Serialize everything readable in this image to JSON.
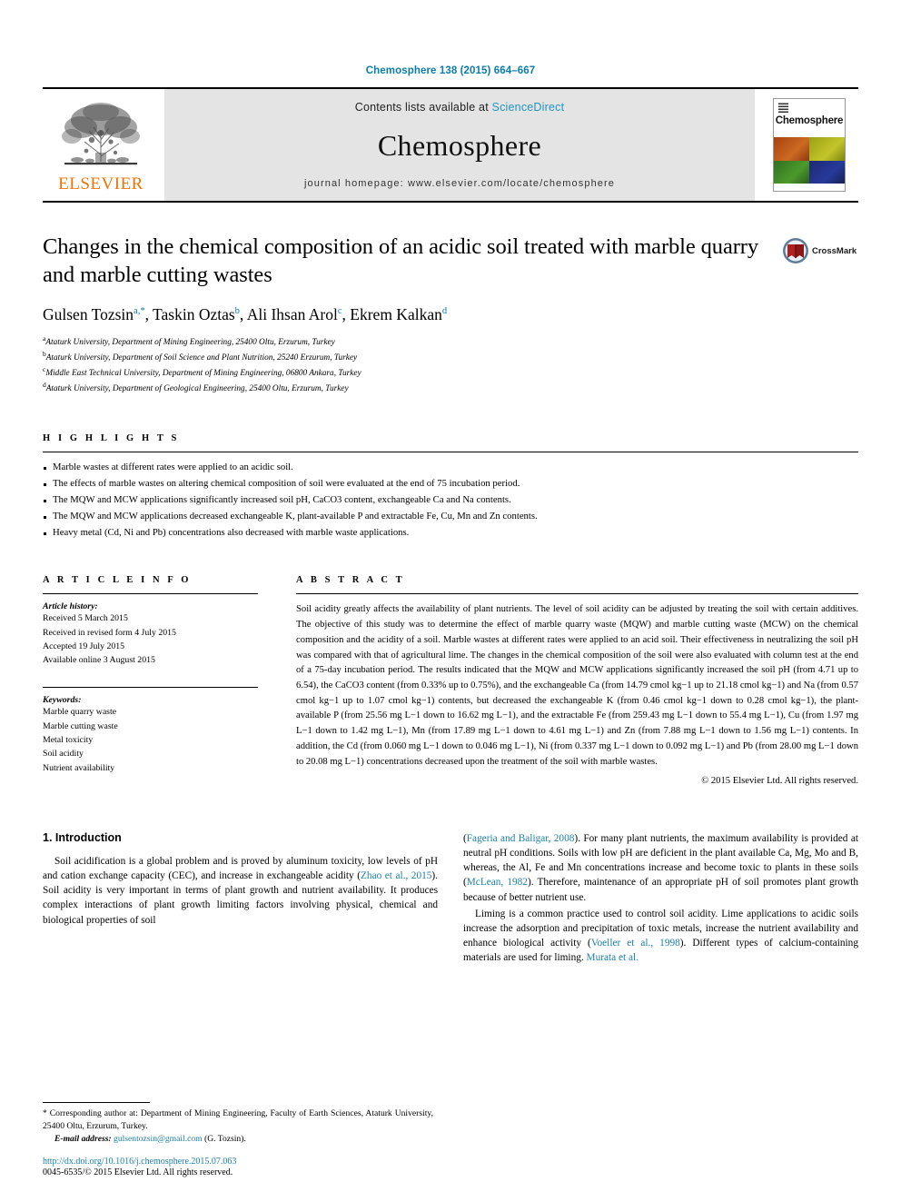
{
  "running_head": "Chemosphere 138 (2015) 664–667",
  "masthead": {
    "contents_prefix": "Contents lists available at ",
    "sciencedirect": "ScienceDirect",
    "journal_name": "Chemosphere",
    "homepage": "journal homepage: www.elsevier.com/locate/chemosphere",
    "publisher_wordmark": "ELSEVIER",
    "cover_title": "Chemosphere"
  },
  "article": {
    "title": "Changes in the chemical composition of an acidic soil treated with marble quarry and marble cutting wastes",
    "crossmark_label": "CrossMark",
    "authors": [
      {
        "name": "Gulsen Tozsin",
        "sup": "a,*"
      },
      {
        "name": "Taskin Oztas",
        "sup": "b"
      },
      {
        "name": "Ali Ihsan Arol",
        "sup": "c"
      },
      {
        "name": "Ekrem Kalkan",
        "sup": "d"
      }
    ],
    "affiliations": [
      {
        "mark": "a",
        "text": "Ataturk University, Department of Mining Engineering, 25400 Oltu, Erzurum, Turkey"
      },
      {
        "mark": "b",
        "text": "Ataturk University, Department of Soil Science and Plant Nutrition, 25240 Erzurum, Turkey"
      },
      {
        "mark": "c",
        "text": "Middle East Technical University, Department of Mining Engineering, 06800 Ankara, Turkey"
      },
      {
        "mark": "d",
        "text": "Ataturk University, Department of Geological Engineering, 25400 Oltu, Erzurum, Turkey"
      }
    ]
  },
  "highlights": {
    "heading": "H I G H L I G H T S",
    "items": [
      "Marble wastes at different rates were applied to an acidic soil.",
      "The effects of marble wastes on altering chemical composition of soil were evaluated at the end of 75 incubation period.",
      "The MQW and MCW applications significantly increased soil pH, CaCO3 content, exchangeable Ca and Na contents.",
      "The MQW and MCW applications decreased exchangeable K, plant-available P and extractable Fe, Cu, Mn and Zn contents.",
      "Heavy metal (Cd, Ni and Pb) concentrations also decreased with marble waste applications."
    ]
  },
  "article_info": {
    "heading": "A R T I C L E    I N F O",
    "history_label": "Article history:",
    "history": [
      "Received 5 March 2015",
      "Received in revised form 4 July 2015",
      "Accepted 19 July 2015",
      "Available online 3 August 2015"
    ],
    "keywords_label": "Keywords:",
    "keywords": [
      "Marble quarry waste",
      "Marble cutting waste",
      "Metal toxicity",
      "Soil acidity",
      "Nutrient availability"
    ]
  },
  "abstract": {
    "heading": "A B S T R A C T",
    "text": "Soil acidity greatly affects the availability of plant nutrients. The level of soil acidity can be adjusted by treating the soil with certain additives. The objective of this study was to determine the effect of marble quarry waste (MQW) and marble cutting waste (MCW) on the chemical composition and the acidity of a soil. Marble wastes at different rates were applied to an acid soil. Their effectiveness in neutralizing the soil pH was compared with that of agricultural lime. The changes in the chemical composition of the soil were also evaluated with column test at the end of a 75-day incubation period. The results indicated that the MQW and MCW applications significantly increased the soil pH (from 4.71 up to 6.54), the CaCO3 content (from 0.33% up to 0.75%), and the exchangeable Ca (from 14.79 cmol kg−1 up to 21.18 cmol kg−1) and Na (from 0.57 cmol kg−1 up to 1.07 cmol kg−1) contents, but decreased the exchangeable K (from 0.46 cmol kg−1 down to 0.28 cmol kg−1), the plant-available P (from 25.56 mg L−1 down to 16.62 mg L−1), and the extractable Fe (from 259.43 mg L−1 down to 55.4 mg L−1), Cu (from 1.97 mg L−1 down to 1.42 mg L−1), Mn (from 17.89 mg L−1 down to 4.61 mg L−1) and Zn (from 7.88 mg L−1 down to 1.56 mg L−1) contents. In addition, the Cd (from 0.060 mg L−1 down to 0.046 mg L−1), Ni (from 0.337 mg L−1 down to 0.092 mg L−1) and Pb (from 28.00 mg L−1 down to 20.08 mg L−1) concentrations decreased upon the treatment of the soil with marble wastes.",
    "copyright": "© 2015 Elsevier Ltd. All rights reserved."
  },
  "introduction": {
    "heading": "1. Introduction",
    "left_paragraph_1_a": "Soil acidification is a global problem and is proved by aluminum toxicity, low levels of pH and cation exchange capacity (CEC), and increase in exchangeable acidity (",
    "left_cite_1": "Zhao et al., 2015",
    "left_paragraph_1_b": "). Soil acidity is very important in terms of plant growth and nutrient availability. It produces complex interactions of plant growth limiting factors involving physical, chemical and biological properties of soil",
    "right_paragraph_1_a": "(",
    "right_cite_1": "Fageria and Baligar, 2008",
    "right_paragraph_1_b": "). For many plant nutrients, the maximum availability is provided at neutral pH conditions. Soils with low pH are deficient in the plant available Ca, Mg, Mo and B, whereas, the Al, Fe and Mn concentrations increase and become toxic to plants in these soils (",
    "right_cite_2": "McLean, 1982",
    "right_paragraph_1_c": "). Therefore, maintenance of an appropriate pH of soil promotes plant growth because of better nutrient use.",
    "right_paragraph_2_a": "Liming is a common practice used to control soil acidity. Lime applications to acidic soils increase the adsorption and precipitation of toxic metals, increase the nutrient availability and enhance biological activity (",
    "right_cite_3": "Voeller et al., 1998",
    "right_paragraph_2_b": "). Different types of calcium-containing materials are used for liming. ",
    "right_cite_4": "Murata et al."
  },
  "footnote": {
    "corresponding": "* Corresponding author at: Department of Mining Engineering, Faculty of Earth Sciences, Ataturk University, 25400 Oltu, Erzurum, Turkey.",
    "email_label": "E-mail address:",
    "email": "gulsentozsin@gmail.com",
    "email_suffix": "(G. Tozsin).",
    "doi": "http://dx.doi.org/10.1016/j.chemosphere.2015.07.063",
    "issn": "0045-6535/© 2015 Elsevier Ltd. All rights reserved."
  },
  "colors": {
    "link_blue": "#1b7fa8",
    "elsevier_orange": "#ec7404",
    "masthead_gray": "#e4e4e4"
  }
}
